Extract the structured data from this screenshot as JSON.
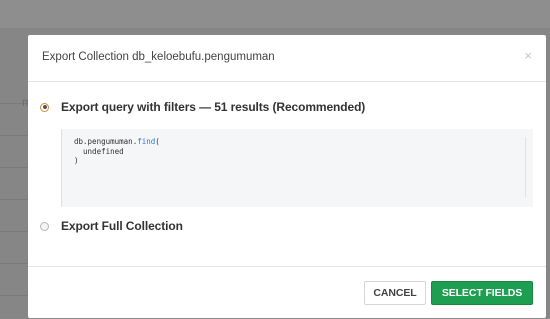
{
  "background": {
    "partial_label": "ma"
  },
  "modal": {
    "title": "Export Collection db_keloebufu.pengumuman",
    "close_glyph": "×",
    "options": [
      {
        "label": "Export query with filters — 51 results (Recommended)",
        "selected": true
      },
      {
        "label": "Export Full Collection",
        "selected": false
      }
    ],
    "code": {
      "object": "db.pengumuman.",
      "method": "find",
      "open": "(",
      "arg": "  undefined",
      "close": ")"
    },
    "footer": {
      "cancel_label": "CANCEL",
      "primary_label": "SELECT FIELDS"
    }
  },
  "colors": {
    "primary_button": "#1e9e50",
    "code_method": "#2b7cc8",
    "radio_accent": "#d18a3a"
  }
}
